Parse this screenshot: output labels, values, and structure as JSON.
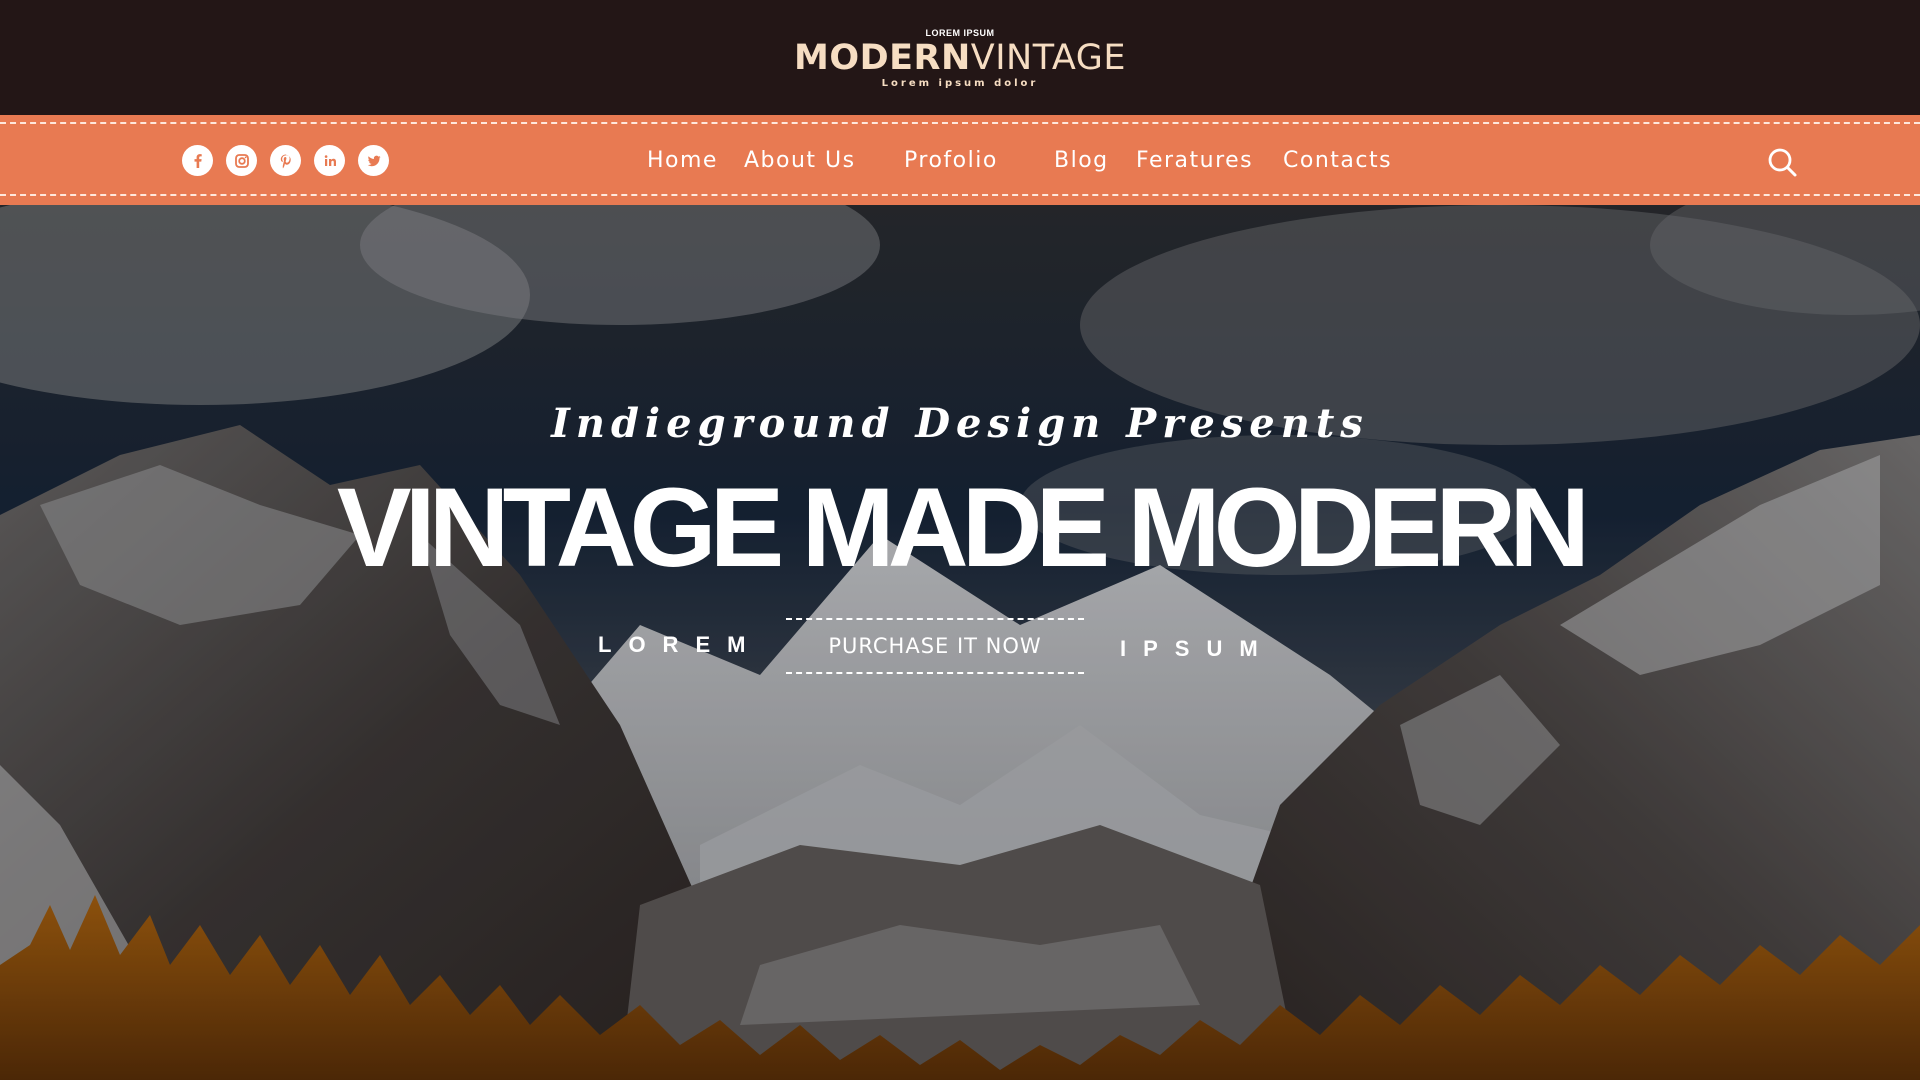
{
  "header": {
    "logo": {
      "kicker": "LOREM IPSUM",
      "word_bold": "MODERN",
      "word_light": "VINTAGE",
      "tagline": "Lorem ipsum dolor"
    }
  },
  "nav": {
    "items": [
      {
        "label": "Home"
      },
      {
        "label": "About Us"
      },
      {
        "label": "Profolio"
      },
      {
        "label": "Blog"
      },
      {
        "label": "Feratures"
      },
      {
        "label": "Contacts"
      }
    ],
    "social": [
      "facebook-icon",
      "instagram-icon",
      "pinterest-icon",
      "linkedin-icon",
      "twitter-icon"
    ],
    "search_icon": "search-icon"
  },
  "hero": {
    "presents": "Indieground Design Presents",
    "headline": "VINTAGE MADE MODERN",
    "left_word": "LOREM",
    "right_word": "IPSUM",
    "cta_label": "PURCHASE IT NOW"
  },
  "colors": {
    "top_bar": "#231616",
    "nav_bar": "#e87a52",
    "logo_text": "#f6ddc2",
    "accent_text": "#ffffff"
  }
}
